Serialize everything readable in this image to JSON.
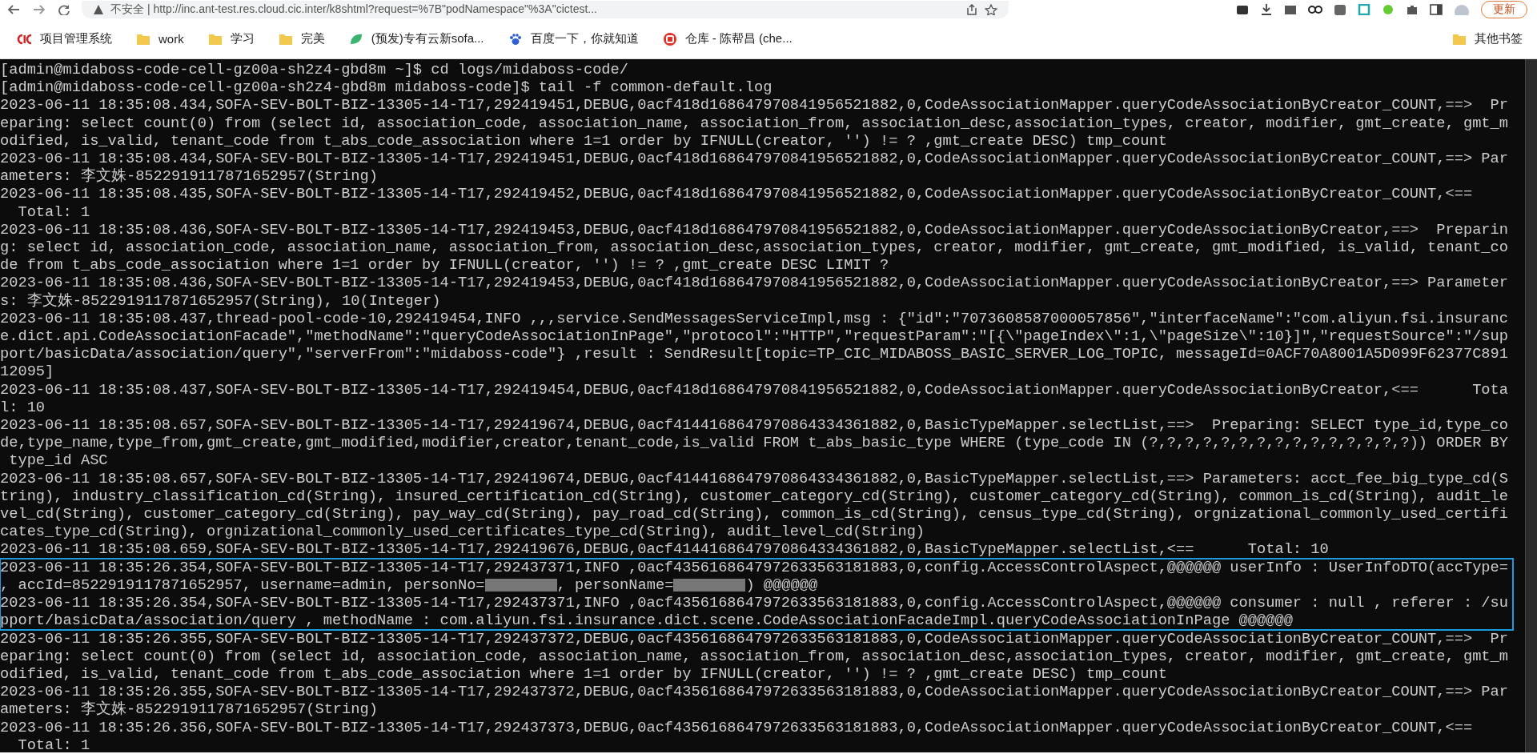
{
  "browser": {
    "address": "不安全 | http://inc.ant-test.res.cloud.cic.inter/k8shtml?request=%7B\"podNamespace\"%3A\"cictest...",
    "update_button": "更新"
  },
  "bookmarks": [
    {
      "label": "项目管理系统",
      "kind": "logo-cic"
    },
    {
      "label": "work",
      "kind": "folder"
    },
    {
      "label": "学习",
      "kind": "folder"
    },
    {
      "label": "完美",
      "kind": "folder"
    },
    {
      "label": "(预发)专有云新sofa...",
      "kind": "leaf"
    },
    {
      "label": "百度一下，你就知道",
      "kind": "paw"
    },
    {
      "label": "仓库 - 陈帮昌 (che...",
      "kind": "logo-repo"
    }
  ],
  "other_bookmarks": "其他书签",
  "terminal": {
    "blocks": [
      {
        "highlighted": false,
        "lines": [
          "[admin@midaboss-code-cell-gz00a-sh2z4-gbd8m ~]$ cd logs/midaboss-code/",
          "[admin@midaboss-code-cell-gz00a-sh2z4-gbd8m midaboss-code]$ tail -f common-default.log",
          "2023-06-11 18:35:08.434,SOFA-SEV-BOLT-BIZ-13305-14-T17,292419451,DEBUG,0acf418d168647970841956521882,0,CodeAssociationMapper.queryCodeAssociationByCreator_COUNT,==>  Pr",
          "eparing: select count(0) from (select id, association_code, association_name, association_from, association_desc,association_types, creator, modifier, gmt_create, gmt_m",
          "odified, is_valid, tenant_code from t_abs_code_association where 1=1 order by IFNULL(creator, '') != ? ,gmt_create DESC) tmp_count",
          "2023-06-11 18:35:08.434,SOFA-SEV-BOLT-BIZ-13305-14-T17,292419451,DEBUG,0acf418d168647970841956521882,0,CodeAssociationMapper.queryCodeAssociationByCreator_COUNT,==> Par",
          "ameters: 李文姝-8522919117871652957(String)",
          "2023-06-11 18:35:08.435,SOFA-SEV-BOLT-BIZ-13305-14-T17,292419452,DEBUG,0acf418d168647970841956521882,0,CodeAssociationMapper.queryCodeAssociationByCreator_COUNT,<==",
          "  Total: 1",
          "2023-06-11 18:35:08.436,SOFA-SEV-BOLT-BIZ-13305-14-T17,292419453,DEBUG,0acf418d168647970841956521882,0,CodeAssociationMapper.queryCodeAssociationByCreator,==>  Preparin",
          "g: select id, association_code, association_name, association_from, association_desc,association_types, creator, modifier, gmt_create, gmt_modified, is_valid, tenant_co",
          "de from t_abs_code_association where 1=1 order by IFNULL(creator, '') != ? ,gmt_create DESC LIMIT ?",
          "2023-06-11 18:35:08.436,SOFA-SEV-BOLT-BIZ-13305-14-T17,292419453,DEBUG,0acf418d168647970841956521882,0,CodeAssociationMapper.queryCodeAssociationByCreator,==> Parameter",
          "s: 李文姝-8522919117871652957(String), 10(Integer)",
          "2023-06-11 18:35:08.437,thread-pool-code-10,292419454,INFO ,,,service.SendMessagesServiceImpl,msg : {\"id\":\"7073608587000057856\",\"interfaceName\":\"com.aliyun.fsi.insuranc",
          "e.dict.api.CodeAssociationFacade\",\"methodName\":\"queryCodeAssociationInPage\",\"protocol\":\"HTTP\",\"requestParam\":\"[{\\\"pageIndex\\\":1,\\\"pageSize\\\":10}]\",\"requestSource\":\"/sup",
          "port/basicData/association/query\",\"serverFrom\":\"midaboss-code\"} ,result : SendResult[topic=TP_CIC_MIDABOSS_BASIC_SERVER_LOG_TOPIC, messageId=0ACF70A8001A5D099F62377C891",
          "12095]",
          "2023-06-11 18:35:08.437,SOFA-SEV-BOLT-BIZ-13305-14-T17,292419454,DEBUG,0acf418d168647970841956521882,0,CodeAssociationMapper.queryCodeAssociationByCreator,<==      Tota",
          "l: 10",
          "2023-06-11 18:35:08.657,SOFA-SEV-BOLT-BIZ-13305-14-T17,292419674,DEBUG,0acf4144168647970864334361882,0,BasicTypeMapper.selectList,==>  Preparing: SELECT type_id,type_co",
          "de,type_name,type_from,gmt_create,gmt_modified,modifier,creator,tenant_code,is_valid FROM t_abs_basic_type WHERE (type_code IN (?,?,?,?,?,?,?,?,?,?,?,?,?,?,?)) ORDER BY",
          " type_id ASC",
          "2023-06-11 18:35:08.657,SOFA-SEV-BOLT-BIZ-13305-14-T17,292419674,DEBUG,0acf4144168647970864334361882,0,BasicTypeMapper.selectList,==> Parameters: acct_fee_big_type_cd(S",
          "tring), industry_classification_cd(String), insured_certification_cd(String), customer_category_cd(String), customer_category_cd(String), common_is_cd(String), audit_le",
          "vel_cd(String), customer_category_cd(String), pay_way_cd(String), pay_road_cd(String), common_is_cd(String), census_type_cd(String), orgnizational_commonly_used_certifi",
          "cates_type_cd(String), orgnizational_commonly_used_certificates_type_cd(String), audit_level_cd(String)",
          "2023-06-11 18:35:08.659,SOFA-SEV-BOLT-BIZ-13305-14-T17,292419676,DEBUG,0acf4144168647970864334361882,0,BasicTypeMapper.selectList,<==      Total: 10"
        ]
      },
      {
        "highlighted": true,
        "lines": [
          "2023-06-11 18:35:26.354,SOFA-SEV-BOLT-BIZ-13305-14-T17,292437371,INFO ,0acf4356168647972633563181883,0,config.AccessControlAspect,@@@@@@ userInfo : UserInfoDTO(accType=",
          {
            "segments": [
              {
                "kind": "text",
                "text": ", accId=8522919117871652957, username=admin, personNo="
              },
              {
                "kind": "redacted"
              },
              {
                "kind": "text",
                "text": ", personName="
              },
              {
                "kind": "redacted"
              },
              {
                "kind": "text",
                "text": ") @@@@@@"
              }
            ]
          },
          "2023-06-11 18:35:26.354,SOFA-SEV-BOLT-BIZ-13305-14-T17,292437371,INFO ,0acf4356168647972633563181883,0,config.AccessControlAspect,@@@@@@ consumer : null , referer : /su",
          "pport/basicData/association/query , methodName : com.aliyun.fsi.insurance.dict.scene.CodeAssociationFacadeImpl.queryCodeAssociationInPage @@@@@@"
        ]
      },
      {
        "highlighted": false,
        "lines": [
          "2023-06-11 18:35:26.355,SOFA-SEV-BOLT-BIZ-13305-14-T17,292437372,DEBUG,0acf4356168647972633563181883,0,CodeAssociationMapper.queryCodeAssociationByCreator_COUNT,==>  Pr",
          "eparing: select count(0) from (select id, association_code, association_name, association_from, association_desc,association_types, creator, modifier, gmt_create, gmt_m",
          "odified, is_valid, tenant_code from t_abs_code_association where 1=1 order by IFNULL(creator, '') != ? ,gmt_create DESC) tmp_count",
          "2023-06-11 18:35:26.355,SOFA-SEV-BOLT-BIZ-13305-14-T17,292437372,DEBUG,0acf4356168647972633563181883,0,CodeAssociationMapper.queryCodeAssociationByCreator_COUNT,==> Par",
          "ameters: 李文姝-8522919117871652957(String)",
          "2023-06-11 18:35:26.356,SOFA-SEV-BOLT-BIZ-13305-14-T17,292437373,DEBUG,0acf4356168647972633563181883,0,CodeAssociationMapper.queryCodeAssociationByCreator_COUNT,<==",
          "  Total: 1"
        ]
      }
    ]
  }
}
